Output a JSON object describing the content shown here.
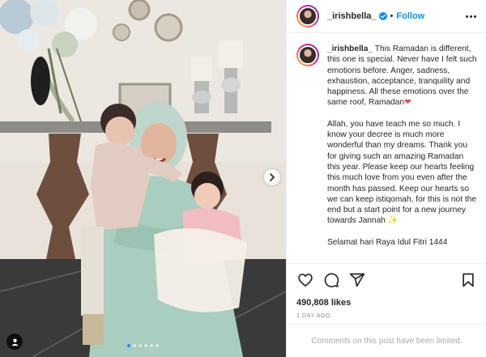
{
  "post": {
    "username": "_irishbella_",
    "separator": "•",
    "follow_label": "Follow",
    "caption": {
      "paragraph1": "This Ramadan is different, this one is special. Never have I felt such emotions before. Anger, sadness, exhaustion, acceptance, tranquility and happiness. All these emotions over the same roof, Ramadan",
      "heart_emoji": "❤",
      "paragraph2": "Allah, you have teach me so much. I know your decree is much more wonderful than my dreams. Thank you for giving such an amazing Ramadan this year. Please keep our hearts feeling this much love from you even after the month has passed. Keep our hearts so we can keep istiqomah, for this is not the end but a start point for a new journey towards Jannah",
      "sparkle_emoji": "✨",
      "paragraph3": "Selamat hari Raya Idul Fitri 1444"
    },
    "likes": "490,808 likes",
    "date": "1 DAY AGO",
    "comments_notice": "Comments on this post have been limited."
  },
  "carousel": {
    "total_slides": 6,
    "active_index": 0
  },
  "icons": {
    "verified": "verified-badge-icon",
    "more": "more-options-icon",
    "like": "heart-icon",
    "comment": "comment-icon",
    "share": "share-icon",
    "save": "bookmark-icon",
    "next": "chevron-right-icon",
    "tag": "user-tag-icon"
  },
  "colors": {
    "accent": "#0095f6",
    "text": "#262626",
    "muted": "#8e8e8e",
    "heart": "#ed4956",
    "carousel_active_dot": "#1e90ff"
  }
}
